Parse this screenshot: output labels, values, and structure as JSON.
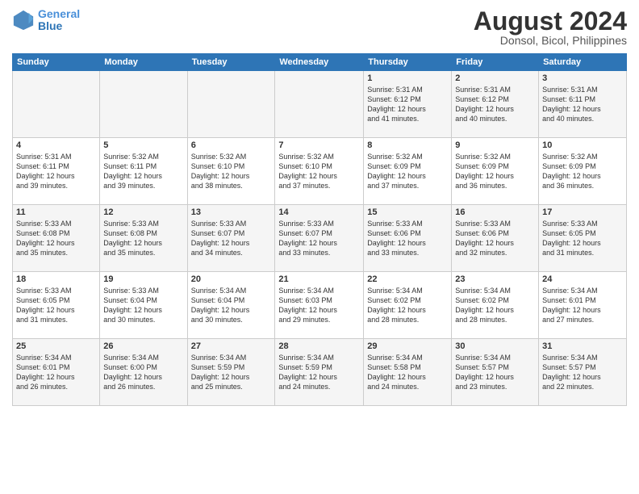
{
  "header": {
    "logo_line1": "General",
    "logo_line2": "Blue",
    "month_title": "August 2024",
    "location": "Donsol, Bicol, Philippines"
  },
  "weekdays": [
    "Sunday",
    "Monday",
    "Tuesday",
    "Wednesday",
    "Thursday",
    "Friday",
    "Saturday"
  ],
  "weeks": [
    [
      {
        "day": "",
        "info": ""
      },
      {
        "day": "",
        "info": ""
      },
      {
        "day": "",
        "info": ""
      },
      {
        "day": "",
        "info": ""
      },
      {
        "day": "1",
        "info": "Sunrise: 5:31 AM\nSunset: 6:12 PM\nDaylight: 12 hours\nand 41 minutes."
      },
      {
        "day": "2",
        "info": "Sunrise: 5:31 AM\nSunset: 6:12 PM\nDaylight: 12 hours\nand 40 minutes."
      },
      {
        "day": "3",
        "info": "Sunrise: 5:31 AM\nSunset: 6:11 PM\nDaylight: 12 hours\nand 40 minutes."
      }
    ],
    [
      {
        "day": "4",
        "info": "Sunrise: 5:31 AM\nSunset: 6:11 PM\nDaylight: 12 hours\nand 39 minutes."
      },
      {
        "day": "5",
        "info": "Sunrise: 5:32 AM\nSunset: 6:11 PM\nDaylight: 12 hours\nand 39 minutes."
      },
      {
        "day": "6",
        "info": "Sunrise: 5:32 AM\nSunset: 6:10 PM\nDaylight: 12 hours\nand 38 minutes."
      },
      {
        "day": "7",
        "info": "Sunrise: 5:32 AM\nSunset: 6:10 PM\nDaylight: 12 hours\nand 37 minutes."
      },
      {
        "day": "8",
        "info": "Sunrise: 5:32 AM\nSunset: 6:09 PM\nDaylight: 12 hours\nand 37 minutes."
      },
      {
        "day": "9",
        "info": "Sunrise: 5:32 AM\nSunset: 6:09 PM\nDaylight: 12 hours\nand 36 minutes."
      },
      {
        "day": "10",
        "info": "Sunrise: 5:32 AM\nSunset: 6:09 PM\nDaylight: 12 hours\nand 36 minutes."
      }
    ],
    [
      {
        "day": "11",
        "info": "Sunrise: 5:33 AM\nSunset: 6:08 PM\nDaylight: 12 hours\nand 35 minutes."
      },
      {
        "day": "12",
        "info": "Sunrise: 5:33 AM\nSunset: 6:08 PM\nDaylight: 12 hours\nand 35 minutes."
      },
      {
        "day": "13",
        "info": "Sunrise: 5:33 AM\nSunset: 6:07 PM\nDaylight: 12 hours\nand 34 minutes."
      },
      {
        "day": "14",
        "info": "Sunrise: 5:33 AM\nSunset: 6:07 PM\nDaylight: 12 hours\nand 33 minutes."
      },
      {
        "day": "15",
        "info": "Sunrise: 5:33 AM\nSunset: 6:06 PM\nDaylight: 12 hours\nand 33 minutes."
      },
      {
        "day": "16",
        "info": "Sunrise: 5:33 AM\nSunset: 6:06 PM\nDaylight: 12 hours\nand 32 minutes."
      },
      {
        "day": "17",
        "info": "Sunrise: 5:33 AM\nSunset: 6:05 PM\nDaylight: 12 hours\nand 31 minutes."
      }
    ],
    [
      {
        "day": "18",
        "info": "Sunrise: 5:33 AM\nSunset: 6:05 PM\nDaylight: 12 hours\nand 31 minutes."
      },
      {
        "day": "19",
        "info": "Sunrise: 5:33 AM\nSunset: 6:04 PM\nDaylight: 12 hours\nand 30 minutes."
      },
      {
        "day": "20",
        "info": "Sunrise: 5:34 AM\nSunset: 6:04 PM\nDaylight: 12 hours\nand 30 minutes."
      },
      {
        "day": "21",
        "info": "Sunrise: 5:34 AM\nSunset: 6:03 PM\nDaylight: 12 hours\nand 29 minutes."
      },
      {
        "day": "22",
        "info": "Sunrise: 5:34 AM\nSunset: 6:02 PM\nDaylight: 12 hours\nand 28 minutes."
      },
      {
        "day": "23",
        "info": "Sunrise: 5:34 AM\nSunset: 6:02 PM\nDaylight: 12 hours\nand 28 minutes."
      },
      {
        "day": "24",
        "info": "Sunrise: 5:34 AM\nSunset: 6:01 PM\nDaylight: 12 hours\nand 27 minutes."
      }
    ],
    [
      {
        "day": "25",
        "info": "Sunrise: 5:34 AM\nSunset: 6:01 PM\nDaylight: 12 hours\nand 26 minutes."
      },
      {
        "day": "26",
        "info": "Sunrise: 5:34 AM\nSunset: 6:00 PM\nDaylight: 12 hours\nand 26 minutes."
      },
      {
        "day": "27",
        "info": "Sunrise: 5:34 AM\nSunset: 5:59 PM\nDaylight: 12 hours\nand 25 minutes."
      },
      {
        "day": "28",
        "info": "Sunrise: 5:34 AM\nSunset: 5:59 PM\nDaylight: 12 hours\nand 24 minutes."
      },
      {
        "day": "29",
        "info": "Sunrise: 5:34 AM\nSunset: 5:58 PM\nDaylight: 12 hours\nand 24 minutes."
      },
      {
        "day": "30",
        "info": "Sunrise: 5:34 AM\nSunset: 5:57 PM\nDaylight: 12 hours\nand 23 minutes."
      },
      {
        "day": "31",
        "info": "Sunrise: 5:34 AM\nSunset: 5:57 PM\nDaylight: 12 hours\nand 22 minutes."
      }
    ]
  ]
}
